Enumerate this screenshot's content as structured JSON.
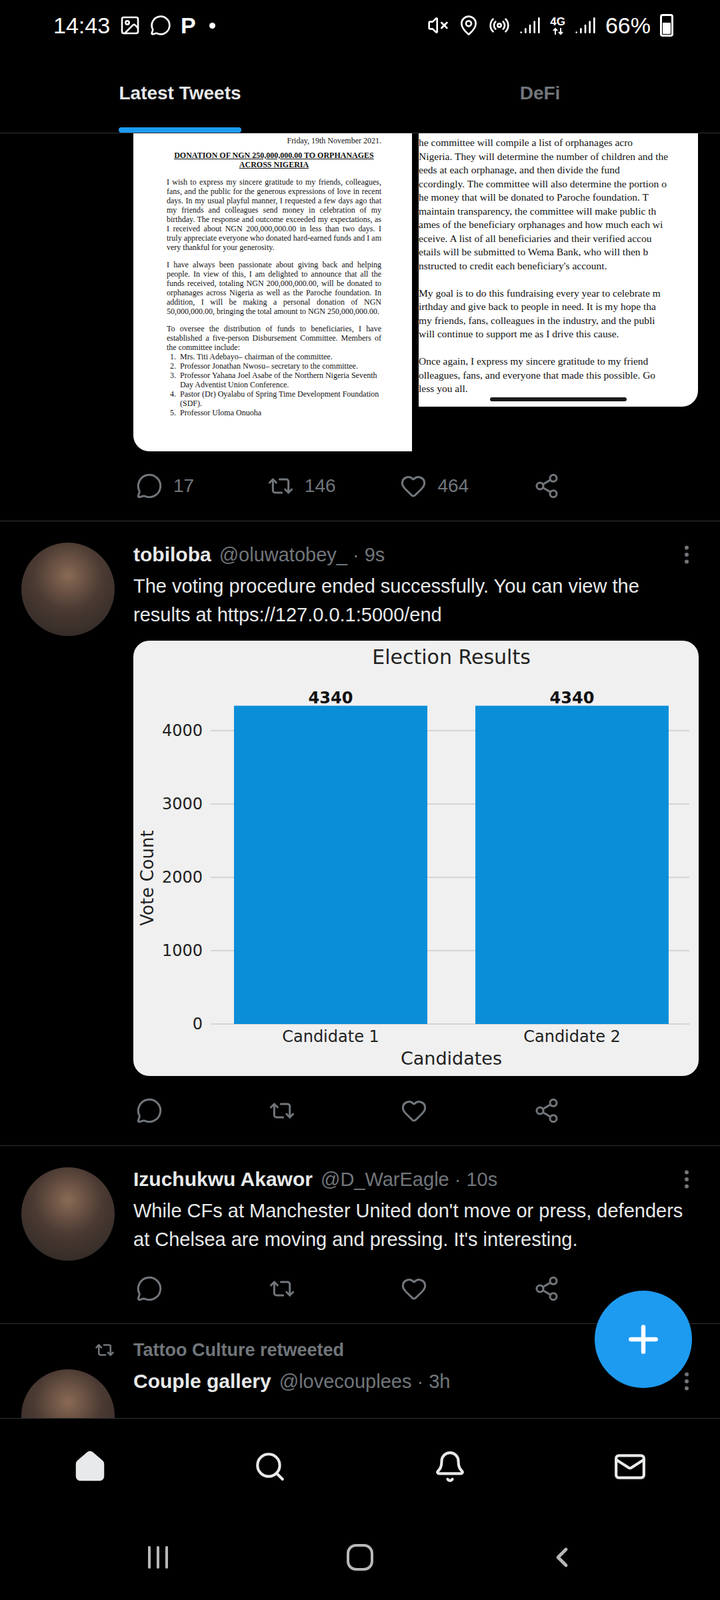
{
  "status_bar": {
    "time": "14:43",
    "app_glyph": "P",
    "network": "4G",
    "battery": "66%",
    "battery_level": 0.66
  },
  "tabs": [
    {
      "label": "Latest Tweets",
      "selected": true
    },
    {
      "label": "DeFi",
      "selected": false
    }
  ],
  "previous_tweet": {
    "document_left": {
      "date": "Friday, 19th November 2021.",
      "title": "DONATION OF NGN 250,000,000.00 TO ORPHANAGES ACROSS NIGERIA",
      "paragraphs": [
        "I wish to express my sincere gratitude to my friends, colleagues, fans, and the public for the generous expressions of love in recent days. In my usual playful manner, I requested a few days ago that my friends and colleagues send money in celebration of my birthday. The response and outcome exceeded my expectations, as I received about NGN 200,000,000.00 in less than two days. I truly appreciate everyone who donated hard-earned funds and I am very thankful for your generosity.",
        "I have always been passionate about giving back and helping people. In view of this, I am delighted to announce that all the funds received, totaling NGN 200,000,000.00, will be donated to orphanages across Nigeria as well as the Paroche foundation. In addition, I will be making a personal donation of NGN 50,000,000.00, bringing the total amount to NGN 250,000,000.00.",
        "To oversee the distribution of funds to beneficiaries, I have established a five-person Disbursement Committee. Members of the committee include:"
      ],
      "list": [
        {
          "number": "1.",
          "text": "Mrs. Titi Adebayo– chairman of the committee."
        },
        {
          "number": "2.",
          "text": "Professor Jonathan Nwosu– secretary to the committee."
        },
        {
          "number": "3.",
          "text": "Professor Yahana Joel Asabe of the Northern Nigeria Seventh Day Adventist Union Conference."
        },
        {
          "number": "4.",
          "text": "Pastor (Dr) Oyalabu of Spring Time Development Foundation (SDF)."
        },
        {
          "number": "5.",
          "text": "Professor Uloma Onuoha"
        }
      ]
    },
    "document_right": {
      "paragraphs": [
        [
          "he committee will compile a list of orphanages acro",
          "Nigeria. They will determine the number of children and the",
          "eeds at each orphanage, and then divide the fund",
          "ccordingly. The committee will also determine the portion o",
          "he money that will be donated to Paroche foundation. T",
          "maintain transparency, the committee will make public th",
          "ames of the beneficiary orphanages and how much each wi",
          "eceive. A list of all beneficiaries and their verified accou",
          "etails will be submitted to Wema Bank, who will then b",
          "nstructed to credit each beneficiary's account."
        ],
        [
          "My goal is to do this fundraising every year to celebrate m",
          "irthday and give back to people in need. It is my hope tha",
          "my friends, fans, colleagues in the industry, and the publi",
          "will continue to support me as I drive this cause."
        ],
        [
          "Once again, I express my sincere gratitude to my friend",
          "olleagues, fans, and everyone that made this possible. Go",
          "less you all."
        ]
      ]
    },
    "actions": [
      {
        "kind": "reply",
        "count": "17"
      },
      {
        "kind": "retweet",
        "count": "146"
      },
      {
        "kind": "like",
        "count": "464"
      },
      {
        "kind": "share"
      }
    ]
  },
  "tweets": [
    {
      "name": "tobiloba",
      "meta": "@oluwatobey_ · 9s",
      "text": "The voting procedure ended successfully. You can view the results at https://127.0.0.1:5000/end",
      "chart": {
        "title": "Election Results",
        "y_label": "Vote Count",
        "x_label": "Candidates",
        "y_ticks": [
          "0",
          "1000",
          "2000",
          "3000",
          "4000"
        ],
        "categories": [
          "Candidate 1",
          "Candidate 2"
        ],
        "values": [
          4340,
          4340
        ],
        "value_labels": [
          "4340",
          "4340"
        ]
      },
      "actions": [
        {
          "kind": "reply"
        },
        {
          "kind": "retweet"
        },
        {
          "kind": "like"
        },
        {
          "kind": "share"
        }
      ]
    },
    {
      "name": "Izuchukwu Akawor",
      "meta": "@D_WarEagle · 10s",
      "text": "While CFs at Manchester United don't move or press, defenders at Chelsea are moving and pressing. It's interesting.",
      "actions": [
        {
          "kind": "reply"
        },
        {
          "kind": "retweet"
        },
        {
          "kind": "like"
        },
        {
          "kind": "share"
        }
      ]
    }
  ],
  "retweet_preview": {
    "retweeted_by": "Tattoo Culture retweeted",
    "name": "Couple gallery",
    "meta": "@lovecouplees · 3h"
  },
  "bottom_nav": [
    {
      "kind": "home",
      "selected": true
    },
    {
      "kind": "search",
      "selected": false
    },
    {
      "kind": "notifications",
      "selected": false
    },
    {
      "kind": "messages",
      "selected": false
    }
  ],
  "system_nav": [
    {
      "kind": "recents"
    },
    {
      "kind": "home"
    },
    {
      "kind": "back"
    }
  ]
}
